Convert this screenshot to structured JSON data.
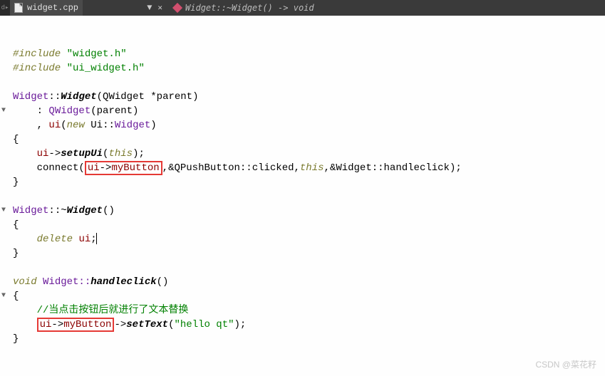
{
  "tab": {
    "filename": "widget.cpp",
    "mod_indicator": "▼",
    "close": "✕"
  },
  "breadcrumb": {
    "text": "Widget::~Widget() -> void"
  },
  "code": {
    "l1a": "#include",
    "l1b": "\"widget.h\"",
    "l2a": "#include",
    "l2b": "\"ui_widget.h\"",
    "l4a": "Widget",
    "l4b": "::",
    "l4c": "Widget",
    "l4d": "(QWidget *parent)",
    "l5a": "    : ",
    "l5b": "QWidget",
    "l5c": "(parent)",
    "l6a": "    , ",
    "l6b": "ui",
    "l6c": "(",
    "l6d": "new",
    "l6e": " Ui::",
    "l6f": "Widget",
    "l6g": ")",
    "l7": "{",
    "l8a": "    ",
    "l8b": "ui",
    "l8c": "->",
    "l8d": "setupUi",
    "l8e": "(",
    "l8f": "this",
    "l8g": ");",
    "l9a": "    connect(",
    "l9b_ui": "ui",
    "l9b_arrow": "->",
    "l9b_btn": "myButton",
    "l9c": ",&QPushButton::clicked,",
    "l9d": "this",
    "l9e": ",&Widget::handleclick);",
    "l10": "}",
    "l12a": "Widget",
    "l12b": "::~",
    "l12c": "Widget",
    "l12d": "()",
    "l13": "{",
    "l14a": "    ",
    "l14b": "delete",
    "l14c": " ",
    "l14d": "ui",
    "l14e": ";",
    "l15": "}",
    "l17a": "void",
    "l17b": " Widget::",
    "l17c": "handleclick",
    "l17d": "()",
    "l18": "{",
    "l19a": "    ",
    "l19b": "//当点击按钮后就进行了文本替换",
    "l20a": "    ",
    "l20b_ui": "ui",
    "l20b_arrow": "->",
    "l20b_btn": "myButton",
    "l20c": "->",
    "l20d": "setText",
    "l20e": "(",
    "l20f": "\"hello qt\"",
    "l20g": ");",
    "l21": "}"
  },
  "watermark": "CSDN @菜花籽"
}
